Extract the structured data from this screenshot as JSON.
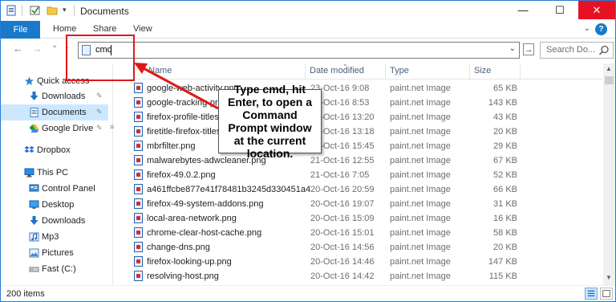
{
  "window": {
    "title": "Documents",
    "controls": {
      "minimize": "—",
      "maximize": "☐",
      "close": "✕"
    }
  },
  "ribbon": {
    "tabs": [
      "File",
      "Home",
      "Share",
      "View"
    ],
    "help": "?"
  },
  "nav": {
    "back": "←",
    "forward": "→",
    "recent": "⌄",
    "up": "↑",
    "address_value": "cmd",
    "address_dropdown": "⌄",
    "go": "→",
    "search_placeholder": "Search Do..."
  },
  "sidebar": {
    "items": [
      {
        "label": "Quick access",
        "icon": "star-icon"
      },
      {
        "label": "Downloads",
        "icon": "download-arrow-icon",
        "pinned": true
      },
      {
        "label": "Documents",
        "icon": "document-icon",
        "pinned": true,
        "selected": true
      },
      {
        "label": "Google Drive",
        "icon": "google-drive-icon",
        "pinned": true
      },
      {
        "label": "Dropbox",
        "icon": "dropbox-icon"
      },
      {
        "label": "This PC",
        "icon": "computer-icon"
      },
      {
        "label": "Control Panel",
        "icon": "control-panel-icon"
      },
      {
        "label": "Desktop",
        "icon": "desktop-icon"
      },
      {
        "label": "Downloads",
        "icon": "download-arrow-icon"
      },
      {
        "label": "Mp3",
        "icon": "music-icon"
      },
      {
        "label": "Pictures",
        "icon": "pictures-icon"
      },
      {
        "label": "Fast (C:)",
        "icon": "drive-icon"
      }
    ],
    "pin_glyph": "📌"
  },
  "columns": [
    "Name",
    "Date modified",
    "Type",
    "Size"
  ],
  "files": [
    {
      "name": "google-web-activity.png",
      "date": "23-Oct-16 9:08",
      "type": "paint.net Image",
      "size": "65 KB"
    },
    {
      "name": "google-tracking-protection.png",
      "date": "23-Oct-16 8:53",
      "type": "paint.net Image",
      "size": "143 KB"
    },
    {
      "name": "firefox-profile-titles.png",
      "date": "21-Oct-16 13:20",
      "type": "paint.net Image",
      "size": "43 KB"
    },
    {
      "name": "firetitle-firefox-titles.png",
      "date": "21-Oct-16 13:18",
      "type": "paint.net Image",
      "size": "20 KB"
    },
    {
      "name": "mbrfilter.png",
      "date": "21-Oct-16 15:45",
      "type": "paint.net Image",
      "size": "29 KB"
    },
    {
      "name": "malwarebytes-adwcleaner.png",
      "date": "21-Oct-16 12:55",
      "type": "paint.net Image",
      "size": "67 KB"
    },
    {
      "name": "firefox-49.0.2.png",
      "date": "21-Oct-16 7:05",
      "type": "paint.net Image",
      "size": "52 KB"
    },
    {
      "name": "a461ffcbe877e41f78481b3245d330451a47...",
      "date": "20-Oct-16 20:59",
      "type": "paint.net Image",
      "size": "66 KB"
    },
    {
      "name": "firefox-49-system-addons.png",
      "date": "20-Oct-16 19:07",
      "type": "paint.net Image",
      "size": "31 KB"
    },
    {
      "name": "local-area-network.png",
      "date": "20-Oct-16 15:09",
      "type": "paint.net Image",
      "size": "16 KB"
    },
    {
      "name": "chrome-clear-host-cache.png",
      "date": "20-Oct-16 15:01",
      "type": "paint.net Image",
      "size": "58 KB"
    },
    {
      "name": "change-dns.png",
      "date": "20-Oct-16 14:56",
      "type": "paint.net Image",
      "size": "20 KB"
    },
    {
      "name": "firefox-looking-up.png",
      "date": "20-Oct-16 14:46",
      "type": "paint.net Image",
      "size": "147 KB"
    },
    {
      "name": "resolving-host.png",
      "date": "20-Oct-16 14:42",
      "type": "paint.net Image",
      "size": "115 KB"
    }
  ],
  "status": {
    "count": "200 items"
  },
  "annotation": {
    "text": "Type cmd, hit Enter, to open a Command Prompt window at the current location.",
    "box_color": "#e01818"
  },
  "colors": {
    "accent": "#1979ca",
    "close_red": "#e81123",
    "selection": "#cce8ff",
    "annotation_red": "#e01818"
  }
}
